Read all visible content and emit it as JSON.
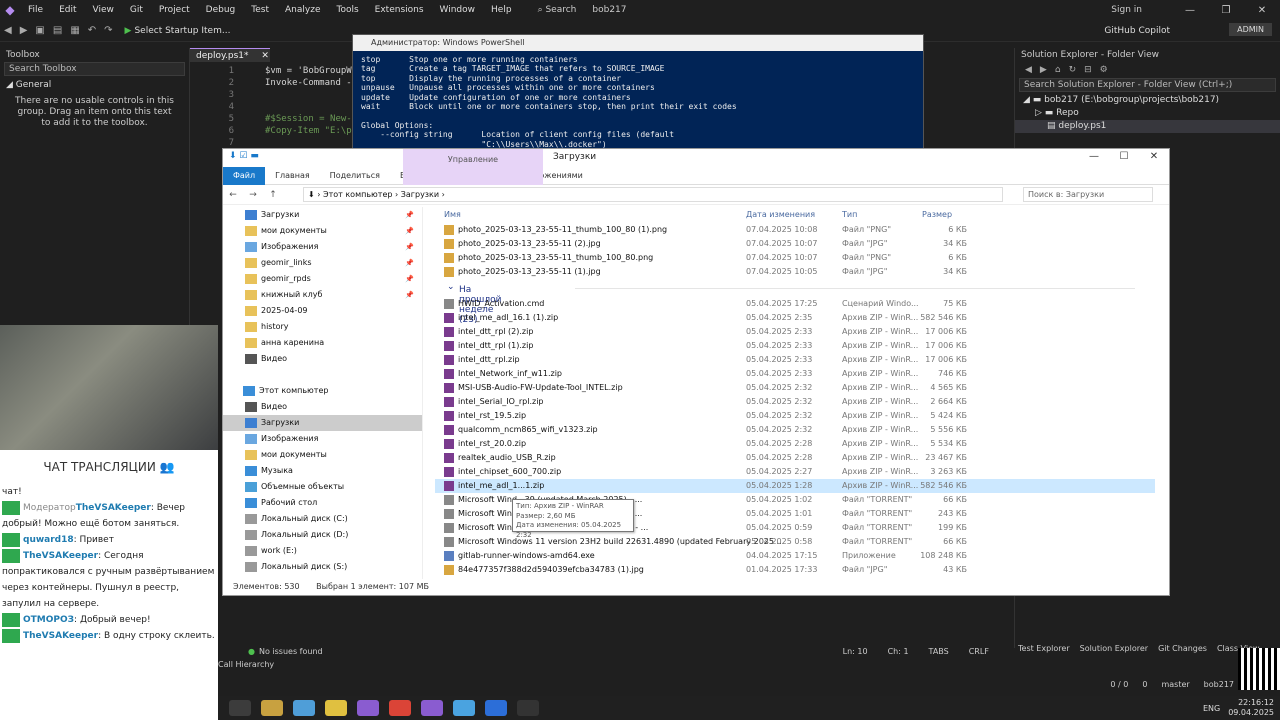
{
  "vs": {
    "menu": [
      "File",
      "Edit",
      "View",
      "Git",
      "Project",
      "Debug",
      "Test",
      "Analyze",
      "Tools",
      "Extensions",
      "Window",
      "Help"
    ],
    "search": "Search",
    "project": "bob217",
    "sign_in": "Sign in",
    "startup": "Select Startup Item...",
    "copilot": "GitHub Copilot",
    "admin": "ADMIN",
    "status_issues": "No issues found",
    "ln": "Ln: 10",
    "ch": "Ch: 1",
    "tabs": "TABS",
    "crlf": "CRLF",
    "call_hierarchy": "Call Hierarchy",
    "bottom_git": "0 / 0",
    "bottom_branch": "master",
    "bottom_repo": "bob217",
    "bottom_changes": "0"
  },
  "toolbox": {
    "title": "Toolbox",
    "search": "Search Toolbox",
    "group": "General",
    "empty": "There are no usable controls in this group. Drag an item onto this text to add it to the toolbox."
  },
  "editor": {
    "tab": "deploy.ps1*",
    "lines": [
      {
        "n": "1",
        "t": "$vm = 'BobGroupW"
      },
      {
        "n": "2",
        "t": "Invoke-Command -"
      },
      {
        "n": "3",
        "t": ""
      },
      {
        "n": "4",
        "t": ""
      },
      {
        "n": "5",
        "t": "#$Session = New-"
      },
      {
        "n": "6",
        "t": "#Copy-Item \"E:\\p"
      },
      {
        "n": "7",
        "t": ""
      }
    ]
  },
  "powershell": {
    "title": "Администратор: Windows PowerShell",
    "text": "stop      Stop one or more running containers\ntag       Create a tag TARGET_IMAGE that refers to SOURCE_IMAGE\ntop       Display the running processes of a container\nunpause   Unpause all processes within one or more containers\nupdate    Update configuration of one or more containers\nwait      Block until one or more containers stop, then print their exit codes\n\nGlobal Options:\n    --config string      Location of client config files (default\n                         \"C:\\\\Users\\\\Max\\\\.docker\")"
  },
  "solution_explorer": {
    "title": "Solution Explorer - Folder View",
    "search": "Search Solution Explorer - Folder View (Ctrl+;)",
    "root": "bob217 (E:\\bobgroup\\projects\\bob217)",
    "repo": "Repo",
    "file": "deploy.ps1",
    "tabs": [
      "Test Explorer",
      "Solution Explorer",
      "Git Changes",
      "Class View"
    ]
  },
  "explorer": {
    "title": "Загрузки",
    "manage": "Управление",
    "ribbon": [
      "Файл",
      "Главная",
      "Поделиться",
      "Вид",
      "Средства работы с приложениями"
    ],
    "path": [
      "Этот компьютер",
      "Загрузки"
    ],
    "search": "Поиск в: Загрузки",
    "headers": [
      "Имя",
      "Дата изменения",
      "Тип",
      "Размер"
    ],
    "nav": [
      {
        "label": "Загрузки",
        "pin": true,
        "color": "#3d7fd1",
        "sel": false
      },
      {
        "label": "мои документы",
        "pin": true,
        "color": "#e8c25a",
        "sel": false
      },
      {
        "label": "Изображения",
        "pin": true,
        "color": "#6aa7e0",
        "sel": false
      },
      {
        "label": "geomir_links",
        "pin": true,
        "color": "#e8c25a",
        "sel": false
      },
      {
        "label": "geomir_rpds",
        "pin": true,
        "color": "#e8c25a",
        "sel": false
      },
      {
        "label": "книжный клуб",
        "pin": true,
        "color": "#e8c25a",
        "sel": false
      },
      {
        "label": "2025-04-09",
        "pin": false,
        "color": "#e8c25a",
        "sel": false
      },
      {
        "label": "history",
        "pin": false,
        "color": "#e8c25a",
        "sel": false
      },
      {
        "label": "анна каренина",
        "pin": false,
        "color": "#e8c25a",
        "sel": false
      },
      {
        "label": "Видео",
        "pin": false,
        "color": "#555",
        "sel": false
      },
      {
        "label": "",
        "pin": false,
        "color": "transparent",
        "sel": false
      },
      {
        "label": "Этот компьютер",
        "pin": false,
        "color": "#3a8ed8",
        "sel": false
      },
      {
        "label": "Видео",
        "pin": false,
        "color": "#555",
        "sel": false
      },
      {
        "label": "Загрузки",
        "pin": false,
        "color": "#3d7fd1",
        "sel": true
      },
      {
        "label": "Изображения",
        "pin": false,
        "color": "#6aa7e0",
        "sel": false
      },
      {
        "label": "мои документы",
        "pin": false,
        "color": "#e8c25a",
        "sel": false
      },
      {
        "label": "Музыка",
        "pin": false,
        "color": "#3a8ed8",
        "sel": false
      },
      {
        "label": "Объемные объекты",
        "pin": false,
        "color": "#4aa0d8",
        "sel": false
      },
      {
        "label": "Рабочий стол",
        "pin": false,
        "color": "#3a8ed8",
        "sel": false
      },
      {
        "label": "Локальный диск (C:)",
        "pin": false,
        "color": "#999",
        "sel": false
      },
      {
        "label": "Локальный диск (D:)",
        "pin": false,
        "color": "#999",
        "sel": false
      },
      {
        "label": "work (E:)",
        "pin": false,
        "color": "#999",
        "sel": false
      },
      {
        "label": "Локальный диск (S:)",
        "pin": false,
        "color": "#999",
        "sel": false
      },
      {
        "label": "",
        "pin": false,
        "color": "transparent",
        "sel": false
      },
      {
        "label": "Сеть",
        "pin": false,
        "color": "#3a8ed8",
        "sel": false
      }
    ],
    "files_top": [
      {
        "name": "photo_2025-03-13_23-55-11_thumb_100_80 (1).png",
        "date": "07.04.2025 10:08",
        "type": "Файл \"PNG\"",
        "size": "6 КБ",
        "icon": "#d8a640"
      },
      {
        "name": "photo_2025-03-13_23-55-11 (2).jpg",
        "date": "07.04.2025 10:07",
        "type": "Файл \"JPG\"",
        "size": "34 КБ",
        "icon": "#d8a640"
      },
      {
        "name": "photo_2025-03-13_23-55-11_thumb_100_80.png",
        "date": "07.04.2025 10:07",
        "type": "Файл \"PNG\"",
        "size": "6 КБ",
        "icon": "#d8a640"
      },
      {
        "name": "photo_2025-03-13_23-55-11 (1).jpg",
        "date": "07.04.2025 10:05",
        "type": "Файл \"JPG\"",
        "size": "34 КБ",
        "icon": "#d8a640"
      }
    ],
    "group_label": "На прошлой неделе (23)",
    "files": [
      {
        "name": "HWID_Activation.cmd",
        "date": "05.04.2025 17:25",
        "type": "Сценарий Windo...",
        "size": "75 КБ",
        "icon": "#888",
        "sel": false
      },
      {
        "name": "intel_me_adl_16.1 (1).zip",
        "date": "05.04.2025 2:35",
        "type": "Архив ZIP - WinR...",
        "size": "582 546 КБ",
        "icon": "#7a3b8e",
        "sel": false
      },
      {
        "name": "intel_dtt_rpl (2).zip",
        "date": "05.04.2025 2:33",
        "type": "Архив ZIP - WinR...",
        "size": "17 006 КБ",
        "icon": "#7a3b8e",
        "sel": false
      },
      {
        "name": "intel_dtt_rpl (1).zip",
        "date": "05.04.2025 2:33",
        "type": "Архив ZIP - WinR...",
        "size": "17 006 КБ",
        "icon": "#7a3b8e",
        "sel": false
      },
      {
        "name": "intel_dtt_rpl.zip",
        "date": "05.04.2025 2:33",
        "type": "Архив ZIP - WinR...",
        "size": "17 006 КБ",
        "icon": "#7a3b8e",
        "sel": false
      },
      {
        "name": "Intel_Network_inf_w11.zip",
        "date": "05.04.2025 2:33",
        "type": "Архив ZIP - WinR...",
        "size": "746 КБ",
        "icon": "#7a3b8e",
        "sel": false
      },
      {
        "name": "MSI-USB-Audio-FW-Update-Tool_INTEL.zip",
        "date": "05.04.2025 2:32",
        "type": "Архив ZIP - WinR...",
        "size": "4 565 КБ",
        "icon": "#7a3b8e",
        "sel": false
      },
      {
        "name": "intel_Serial_IO_rpl.zip",
        "date": "05.04.2025 2:32",
        "type": "Архив ZIP - WinR...",
        "size": "2 664 КБ",
        "icon": "#7a3b8e",
        "sel": false
      },
      {
        "name": "intel_rst_19.5.zip",
        "date": "05.04.2025 2:32",
        "type": "Архив ZIP - WinR...",
        "size": "5 424 КБ",
        "icon": "#7a3b8e",
        "sel": false
      },
      {
        "name": "qualcomm_ncm865_wifi_v1323.zip",
        "date": "05.04.2025 2:32",
        "type": "Архив ZIP - WinR...",
        "size": "5 556 КБ",
        "icon": "#7a3b8e",
        "sel": false
      },
      {
        "name": "intel_rst_20.0.zip",
        "date": "05.04.2025 2:28",
        "type": "Архив ZIP - WinR...",
        "size": "5 534 КБ",
        "icon": "#7a3b8e",
        "sel": false
      },
      {
        "name": "realtek_audio_USB_R.zip",
        "date": "05.04.2025 2:28",
        "type": "Архив ZIP - WinR...",
        "size": "23 467 КБ",
        "icon": "#7a3b8e",
        "sel": false
      },
      {
        "name": "intel_chipset_600_700.zip",
        "date": "05.04.2025 2:27",
        "type": "Архив ZIP - WinR...",
        "size": "3 263 КБ",
        "icon": "#7a3b8e",
        "sel": false
      },
      {
        "name": "intel_me_adl_1...1.zip",
        "date": "05.04.2025 1:28",
        "type": "Архив ZIP - WinR...",
        "size": "582 546 КБ",
        "icon": "#7a3b8e",
        "sel": true
      },
      {
        "name": "Microsoft Wind...39 (updated March 2025) - ...",
        "date": "05.04.2025 1:02",
        "type": "Файл \"TORRENT\"",
        "size": "66 КБ",
        "icon": "#888",
        "sel": false
      },
      {
        "name": "Microsoft Wind...76 (updated March 2025) - ...",
        "date": "05.04.2025 1:01",
        "type": "Файл \"TORRENT\"",
        "size": "243 КБ",
        "icon": "#888",
        "sel": false
      },
      {
        "name": "Microsoft Wind...51 (updated January 2025) - ...",
        "date": "05.04.2025 0:59",
        "type": "Файл \"TORRENT\"",
        "size": "199 КБ",
        "icon": "#888",
        "sel": false
      },
      {
        "name": "Microsoft Windows 11 version 23H2 build 22631.4890 (updated February 2025 ...",
        "date": "05.04.2025 0:58",
        "type": "Файл \"TORRENT\"",
        "size": "66 КБ",
        "icon": "#888",
        "sel": false
      },
      {
        "name": "gitlab-runner-windows-amd64.exe",
        "date": "04.04.2025 17:15",
        "type": "Приложение",
        "size": "108 248 КБ",
        "icon": "#5a7fc0",
        "sel": false
      },
      {
        "name": "84e477357f388d2d594039efcba34783 (1).jpg",
        "date": "01.04.2025 17:33",
        "type": "Файл \"JPG\"",
        "size": "43 КБ",
        "icon": "#d8a640",
        "sel": false
      }
    ],
    "tooltip": [
      "Тип: Архив ZIP - WinRAR",
      "Размер: 2,60 МБ",
      "Дата изменения: 05.04.2025 2:32"
    ],
    "status_count": "Элементов: 530",
    "status_sel": "Выбран 1 элемент: 107 МБ"
  },
  "chat": {
    "title": "ЧАТ ТРАНСЛЯЦИИ",
    "messages": [
      {
        "nick": "",
        "text": "чат!",
        "role": ""
      },
      {
        "nick": "TheVSAKeeper",
        "text": ": Вечер добрый! Можно ещё ботом заняться.",
        "role": "Модератор"
      },
      {
        "nick": "quward18",
        "text": ": Привет",
        "role": ""
      },
      {
        "nick": "TheVSAKeeper",
        "text": ": Сегодня попрактиковался с ручным развёртыванием через контейнеры. Пушнул в реестр, запулил на сервере.",
        "role": ""
      },
      {
        "nick": "ОТМОРОЗ",
        "text": ": Добрый вечер!",
        "role": ""
      },
      {
        "nick": "TheVSAKeeper",
        "text": ": В одну строку склеить.",
        "role": ""
      }
    ]
  },
  "taskbar": {
    "lang": "ENG",
    "time": "22:16:12",
    "date": "09.04.2025",
    "apps": [
      "#3c3c3c",
      "#c8a140",
      "#4f9ed8",
      "#e0c040",
      "#8a5cd0",
      "#db4437",
      "#8a5cd0",
      "#4aa3e0",
      "#2c6ed8",
      "#333"
    ]
  }
}
